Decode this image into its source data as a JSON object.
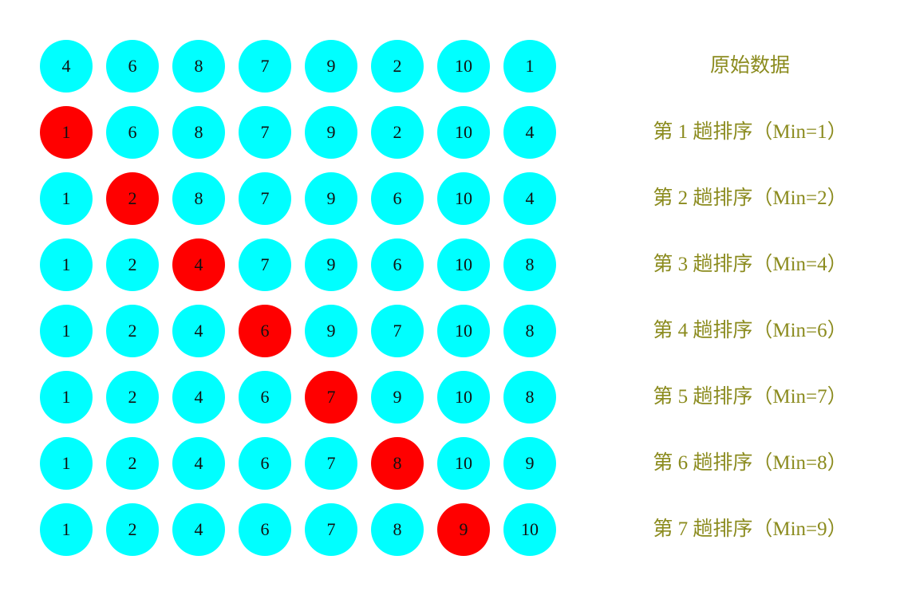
{
  "colors": {
    "default_fill": "#00FFFF",
    "highlight_fill": "#FF0000",
    "label_text": "#8B8B1E",
    "number_text": "#111111"
  },
  "rows": [
    {
      "label": "原始数据",
      "values": [
        "4",
        "6",
        "8",
        "7",
        "9",
        "2",
        "10",
        "1"
      ],
      "highlight_index": null
    },
    {
      "label": "第 1 趟排序（Min=1）",
      "values": [
        "1",
        "6",
        "8",
        "7",
        "9",
        "2",
        "10",
        "4"
      ],
      "highlight_index": 0
    },
    {
      "label": "第 2 趟排序（Min=2）",
      "values": [
        "1",
        "2",
        "8",
        "7",
        "9",
        "6",
        "10",
        "4"
      ],
      "highlight_index": 1
    },
    {
      "label": "第 3 趟排序（Min=4）",
      "values": [
        "1",
        "2",
        "4",
        "7",
        "9",
        "6",
        "10",
        "8"
      ],
      "highlight_index": 2
    },
    {
      "label": "第 4 趟排序（Min=6）",
      "values": [
        "1",
        "2",
        "4",
        "6",
        "9",
        "7",
        "10",
        "8"
      ],
      "highlight_index": 3
    },
    {
      "label": "第 5 趟排序（Min=7）",
      "values": [
        "1",
        "2",
        "4",
        "6",
        "7",
        "9",
        "10",
        "8"
      ],
      "highlight_index": 4
    },
    {
      "label": "第 6 趟排序（Min=8）",
      "values": [
        "1",
        "2",
        "4",
        "6",
        "7",
        "8",
        "10",
        "9"
      ],
      "highlight_index": 5
    },
    {
      "label": "第 7 趟排序（Min=9）",
      "values": [
        "1",
        "2",
        "4",
        "6",
        "7",
        "8",
        "9",
        "10"
      ],
      "highlight_index": 6
    }
  ]
}
